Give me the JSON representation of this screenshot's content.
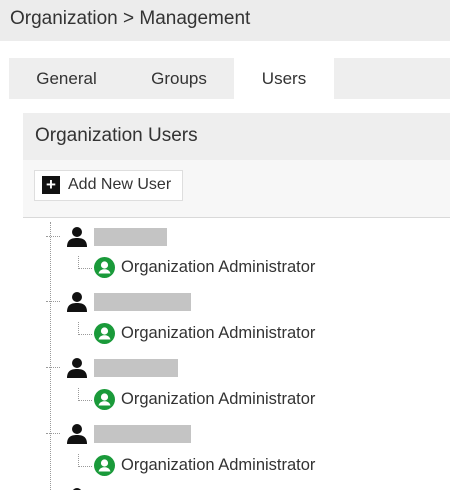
{
  "header": {
    "breadcrumb": "Organization > Management"
  },
  "tabs": [
    {
      "label": "General",
      "active": false
    },
    {
      "label": "Groups",
      "active": false
    },
    {
      "label": "Users",
      "active": true
    }
  ],
  "panel": {
    "title": "Organization Users"
  },
  "toolbar": {
    "add_user_label": "Add New User",
    "add_icon": "plus-square-icon"
  },
  "users": [
    {
      "name_redacted": true,
      "role": "Organization Administrator",
      "role_icon": "user-circle-icon"
    },
    {
      "name_redacted": true,
      "role": "Organization Administrator",
      "role_icon": "user-circle-icon"
    },
    {
      "name_redacted": true,
      "role": "Organization Administrator",
      "role_icon": "user-circle-icon"
    },
    {
      "name_redacted": true,
      "role": "Organization Administrator",
      "role_icon": "user-circle-icon"
    }
  ],
  "colors": {
    "role_icon": "#1a9a3a",
    "header_bg": "#ececec",
    "redaction": "#c4c4c4"
  }
}
